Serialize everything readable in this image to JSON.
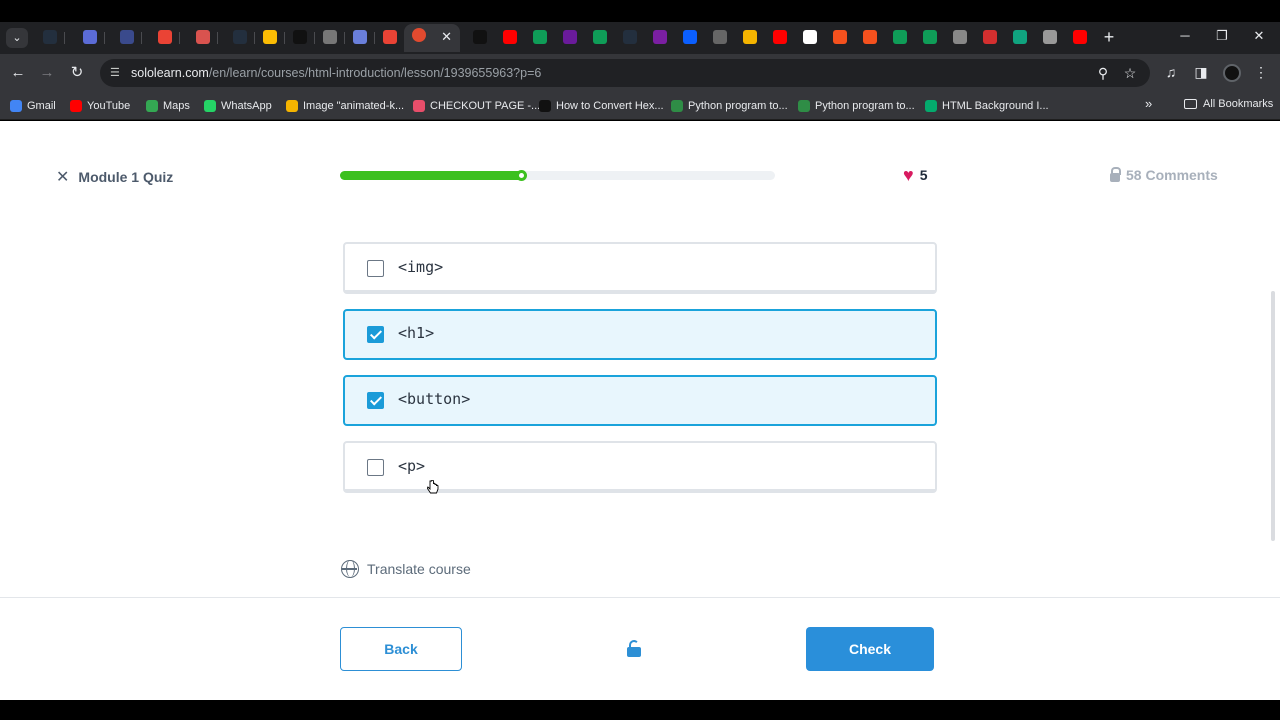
{
  "browser": {
    "url_domain": "sololearn.com",
    "url_path": "/en/learn/courses/html-introduction/lesson/1939655963?p=6",
    "tabs": [
      {
        "icon": "aws-favicon",
        "color": "#232f3e"
      },
      {
        "icon": "g-circle-favicon",
        "color": "#5b6bd6"
      },
      {
        "icon": "monitor-favicon",
        "color": "#3a4a8c"
      },
      {
        "icon": "gmail-favicon",
        "color": "#ea4335"
      },
      {
        "icon": "red-doc-favicon",
        "color": "#d9534f"
      },
      {
        "icon": "aws-favicon",
        "color": "#232f3e"
      },
      {
        "icon": "drive-favicon",
        "color": "#fbbc04"
      },
      {
        "icon": "dark-app-favicon",
        "color": "#111111"
      },
      {
        "icon": "dash-favicon",
        "color": "#777777"
      },
      {
        "icon": "pen-favicon",
        "color": "#6a7fdb"
      },
      {
        "icon": "gmail-favicon",
        "color": "#ea4335"
      },
      {
        "icon": "chrome-color-favicon",
        "color": "#9b59b6"
      }
    ],
    "bookmarks": [
      {
        "label": "Gmail",
        "icon": "google-docs-icon",
        "color": "#4285f4"
      },
      {
        "label": "YouTube",
        "icon": "youtube-icon",
        "color": "#ff0000"
      },
      {
        "label": "Maps",
        "icon": "maps-icon",
        "color": "#34a853"
      },
      {
        "label": "WhatsApp",
        "icon": "whatsapp-icon",
        "color": "#25d366"
      },
      {
        "label": "Image \"animated-k...",
        "icon": "star-image-icon",
        "color": "#f5b400"
      },
      {
        "label": "CHECKOUT PAGE -...",
        "icon": "checkout-icon",
        "color": "#e84e6a"
      },
      {
        "label": "How to Convert Hex...",
        "icon": "alpha-icon",
        "color": "#111111"
      },
      {
        "label": "Python program to...",
        "icon": "gfg-icon",
        "color": "#2f8d46"
      },
      {
        "label": "Python program to...",
        "icon": "gfg-icon",
        "color": "#2f8d46"
      },
      {
        "label": "HTML Background I...",
        "icon": "w-icon",
        "color": "#04aa6d"
      }
    ],
    "all_bookmarks_label": "All Bookmarks"
  },
  "header": {
    "quiz_title": "Module 1 Quiz",
    "progress_fraction": 0.42,
    "hearts": "5",
    "comments": "58 Comments"
  },
  "options": [
    {
      "label": "<img>",
      "checked": false
    },
    {
      "label": "<h1>",
      "checked": true
    },
    {
      "label": "<button>",
      "checked": true
    },
    {
      "label": "<p>",
      "checked": false
    }
  ],
  "translate_label": "Translate course",
  "footer": {
    "back_label": "Back",
    "check_label": "Check"
  },
  "colors": {
    "accent": "#2a8fda",
    "progress": "#3cc01f",
    "heart": "#d81b60",
    "checked_bg": "#e8f6fd"
  }
}
